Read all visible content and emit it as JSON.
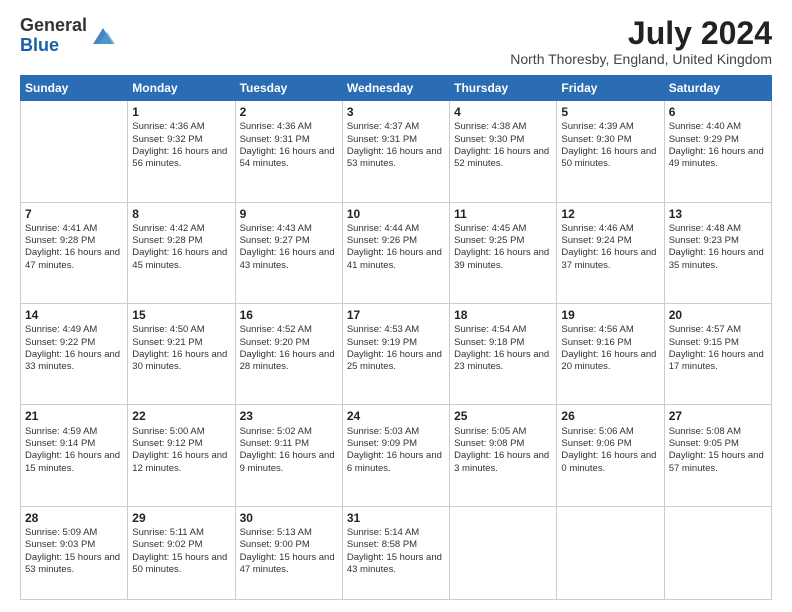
{
  "logo": {
    "general": "General",
    "blue": "Blue"
  },
  "title": "July 2024",
  "location": "North Thoresby, England, United Kingdom",
  "weekdays": [
    "Sunday",
    "Monday",
    "Tuesday",
    "Wednesday",
    "Thursday",
    "Friday",
    "Saturday"
  ],
  "weeks": [
    [
      {
        "day": "",
        "info": ""
      },
      {
        "day": "1",
        "info": "Sunrise: 4:36 AM\nSunset: 9:32 PM\nDaylight: 16 hours\nand 56 minutes."
      },
      {
        "day": "2",
        "info": "Sunrise: 4:36 AM\nSunset: 9:31 PM\nDaylight: 16 hours\nand 54 minutes."
      },
      {
        "day": "3",
        "info": "Sunrise: 4:37 AM\nSunset: 9:31 PM\nDaylight: 16 hours\nand 53 minutes."
      },
      {
        "day": "4",
        "info": "Sunrise: 4:38 AM\nSunset: 9:30 PM\nDaylight: 16 hours\nand 52 minutes."
      },
      {
        "day": "5",
        "info": "Sunrise: 4:39 AM\nSunset: 9:30 PM\nDaylight: 16 hours\nand 50 minutes."
      },
      {
        "day": "6",
        "info": "Sunrise: 4:40 AM\nSunset: 9:29 PM\nDaylight: 16 hours\nand 49 minutes."
      }
    ],
    [
      {
        "day": "7",
        "info": "Sunrise: 4:41 AM\nSunset: 9:28 PM\nDaylight: 16 hours\nand 47 minutes."
      },
      {
        "day": "8",
        "info": "Sunrise: 4:42 AM\nSunset: 9:28 PM\nDaylight: 16 hours\nand 45 minutes."
      },
      {
        "day": "9",
        "info": "Sunrise: 4:43 AM\nSunset: 9:27 PM\nDaylight: 16 hours\nand 43 minutes."
      },
      {
        "day": "10",
        "info": "Sunrise: 4:44 AM\nSunset: 9:26 PM\nDaylight: 16 hours\nand 41 minutes."
      },
      {
        "day": "11",
        "info": "Sunrise: 4:45 AM\nSunset: 9:25 PM\nDaylight: 16 hours\nand 39 minutes."
      },
      {
        "day": "12",
        "info": "Sunrise: 4:46 AM\nSunset: 9:24 PM\nDaylight: 16 hours\nand 37 minutes."
      },
      {
        "day": "13",
        "info": "Sunrise: 4:48 AM\nSunset: 9:23 PM\nDaylight: 16 hours\nand 35 minutes."
      }
    ],
    [
      {
        "day": "14",
        "info": "Sunrise: 4:49 AM\nSunset: 9:22 PM\nDaylight: 16 hours\nand 33 minutes."
      },
      {
        "day": "15",
        "info": "Sunrise: 4:50 AM\nSunset: 9:21 PM\nDaylight: 16 hours\nand 30 minutes."
      },
      {
        "day": "16",
        "info": "Sunrise: 4:52 AM\nSunset: 9:20 PM\nDaylight: 16 hours\nand 28 minutes."
      },
      {
        "day": "17",
        "info": "Sunrise: 4:53 AM\nSunset: 9:19 PM\nDaylight: 16 hours\nand 25 minutes."
      },
      {
        "day": "18",
        "info": "Sunrise: 4:54 AM\nSunset: 9:18 PM\nDaylight: 16 hours\nand 23 minutes."
      },
      {
        "day": "19",
        "info": "Sunrise: 4:56 AM\nSunset: 9:16 PM\nDaylight: 16 hours\nand 20 minutes."
      },
      {
        "day": "20",
        "info": "Sunrise: 4:57 AM\nSunset: 9:15 PM\nDaylight: 16 hours\nand 17 minutes."
      }
    ],
    [
      {
        "day": "21",
        "info": "Sunrise: 4:59 AM\nSunset: 9:14 PM\nDaylight: 16 hours\nand 15 minutes."
      },
      {
        "day": "22",
        "info": "Sunrise: 5:00 AM\nSunset: 9:12 PM\nDaylight: 16 hours\nand 12 minutes."
      },
      {
        "day": "23",
        "info": "Sunrise: 5:02 AM\nSunset: 9:11 PM\nDaylight: 16 hours\nand 9 minutes."
      },
      {
        "day": "24",
        "info": "Sunrise: 5:03 AM\nSunset: 9:09 PM\nDaylight: 16 hours\nand 6 minutes."
      },
      {
        "day": "25",
        "info": "Sunrise: 5:05 AM\nSunset: 9:08 PM\nDaylight: 16 hours\nand 3 minutes."
      },
      {
        "day": "26",
        "info": "Sunrise: 5:06 AM\nSunset: 9:06 PM\nDaylight: 16 hours\nand 0 minutes."
      },
      {
        "day": "27",
        "info": "Sunrise: 5:08 AM\nSunset: 9:05 PM\nDaylight: 15 hours\nand 57 minutes."
      }
    ],
    [
      {
        "day": "28",
        "info": "Sunrise: 5:09 AM\nSunset: 9:03 PM\nDaylight: 15 hours\nand 53 minutes."
      },
      {
        "day": "29",
        "info": "Sunrise: 5:11 AM\nSunset: 9:02 PM\nDaylight: 15 hours\nand 50 minutes."
      },
      {
        "day": "30",
        "info": "Sunrise: 5:13 AM\nSunset: 9:00 PM\nDaylight: 15 hours\nand 47 minutes."
      },
      {
        "day": "31",
        "info": "Sunrise: 5:14 AM\nSunset: 8:58 PM\nDaylight: 15 hours\nand 43 minutes."
      },
      {
        "day": "",
        "info": ""
      },
      {
        "day": "",
        "info": ""
      },
      {
        "day": "",
        "info": ""
      }
    ]
  ]
}
